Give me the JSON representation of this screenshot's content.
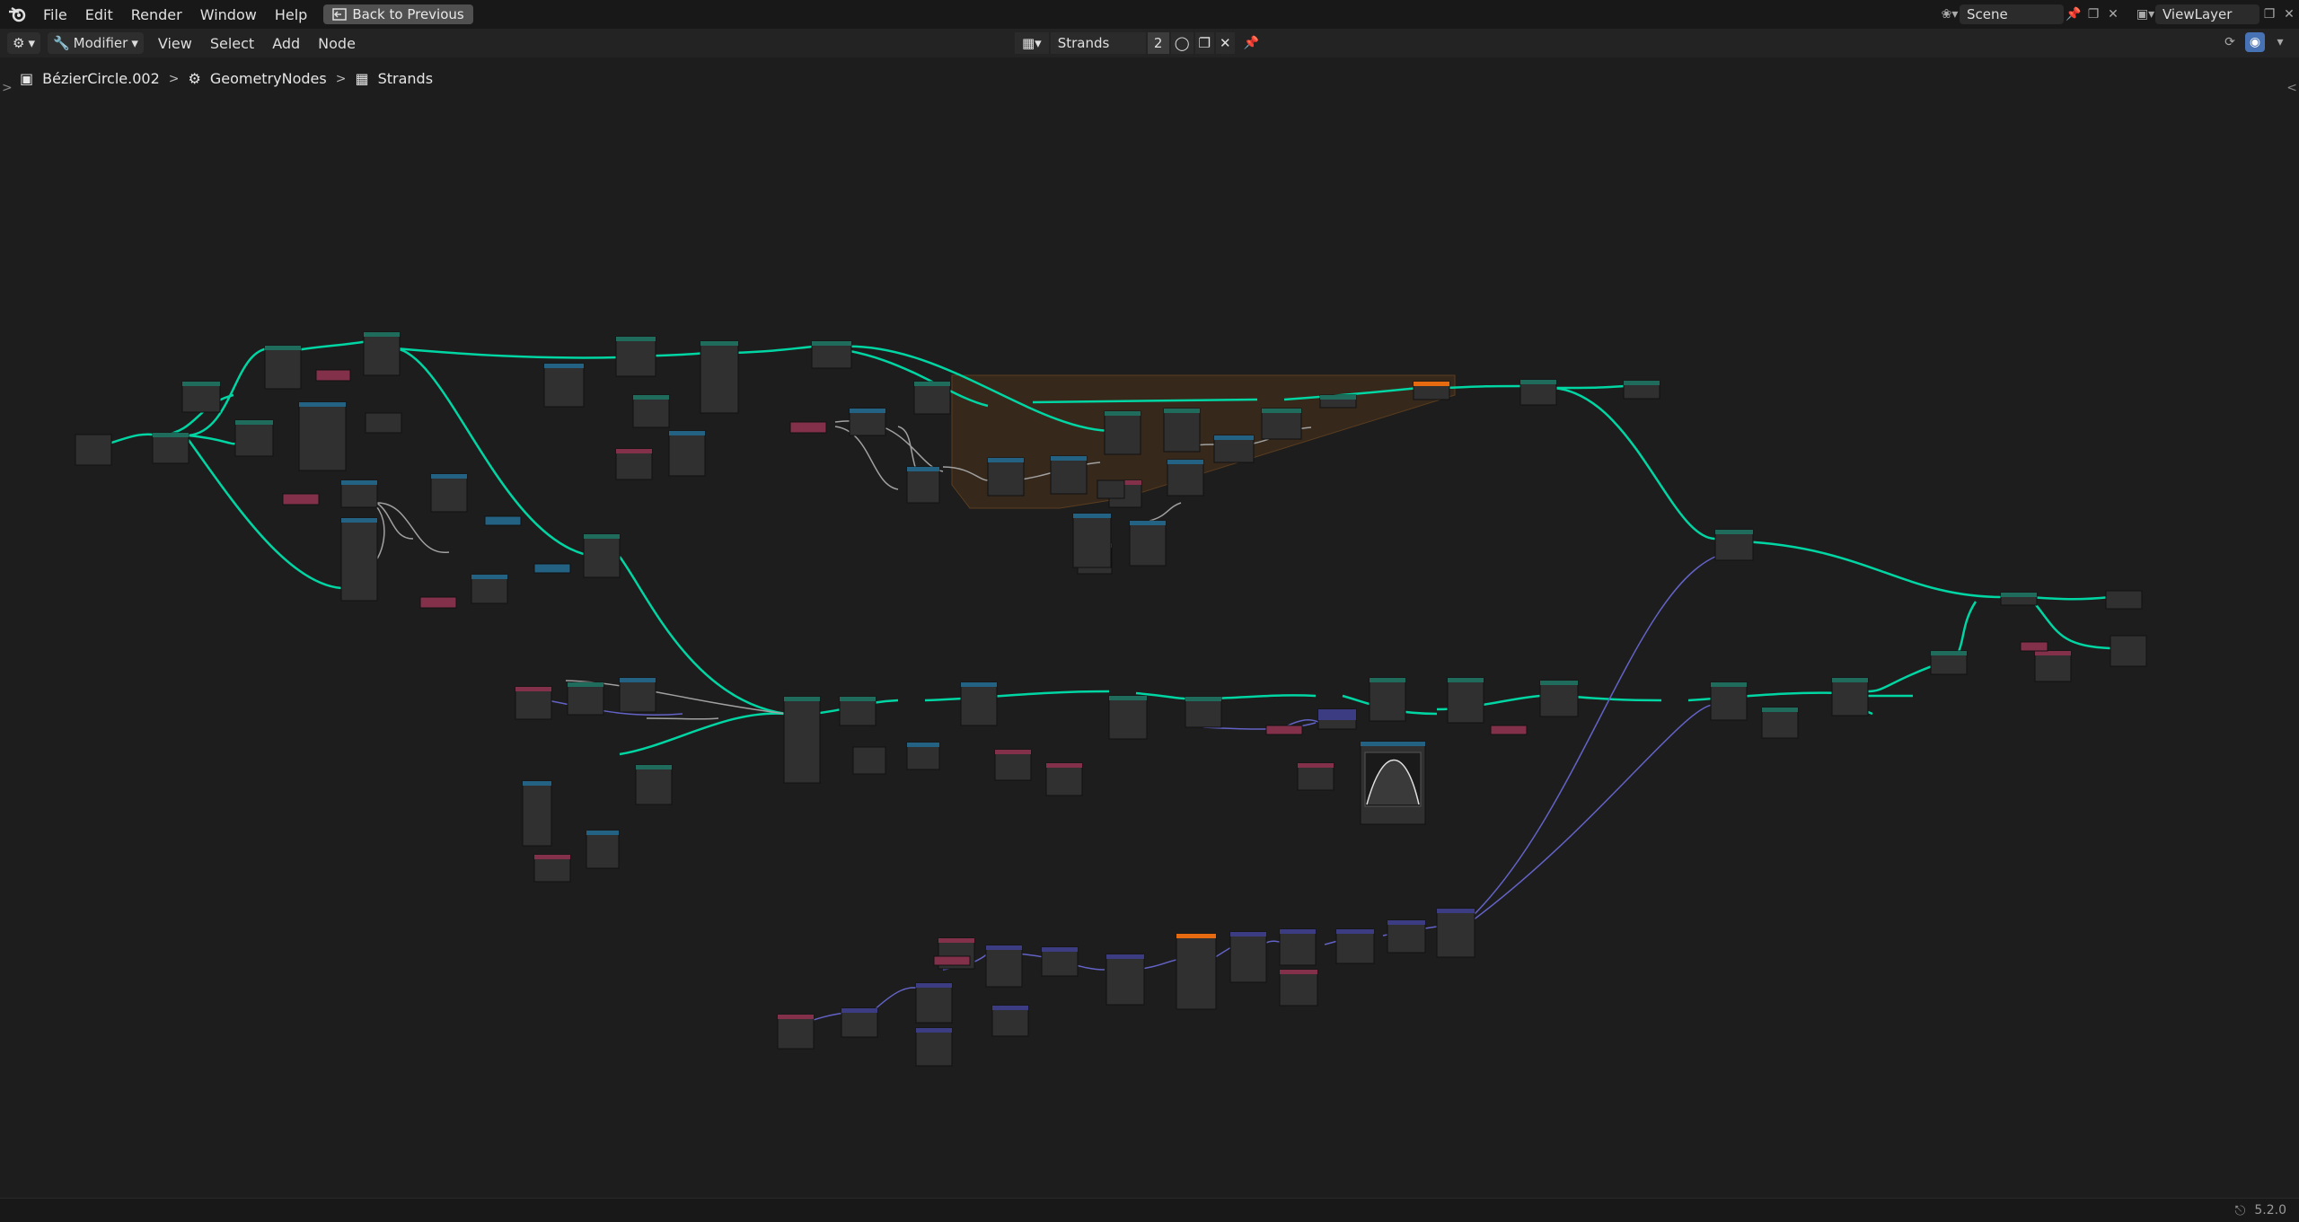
{
  "topbar": {
    "menu": [
      "File",
      "Edit",
      "Render",
      "Window",
      "Help"
    ],
    "back_label": "Back to Previous",
    "scene_name": "Scene",
    "view_layer": "ViewLayer"
  },
  "header": {
    "editor_mode": "Modifier",
    "menus": [
      "View",
      "Select",
      "Add",
      "Node"
    ],
    "node_tree_name": "Strands",
    "node_tree_users": "2"
  },
  "breadcrumb": {
    "object": "BézierCircle.002",
    "modifier": "GeometryNodes",
    "node_tree": "Strands"
  },
  "status": {
    "version": "5.2.0"
  },
  "colors": {
    "geometry_link": "#00d6a3",
    "float_link": "#a1a1a1",
    "vector_link": "#6363c7",
    "frame": "#5a3d20",
    "header_geometry": "#1f6b5c",
    "header_input": "#83314a",
    "header_converter": "#246283",
    "header_vector": "#3c3c83",
    "header_texture": "#e66a10"
  }
}
